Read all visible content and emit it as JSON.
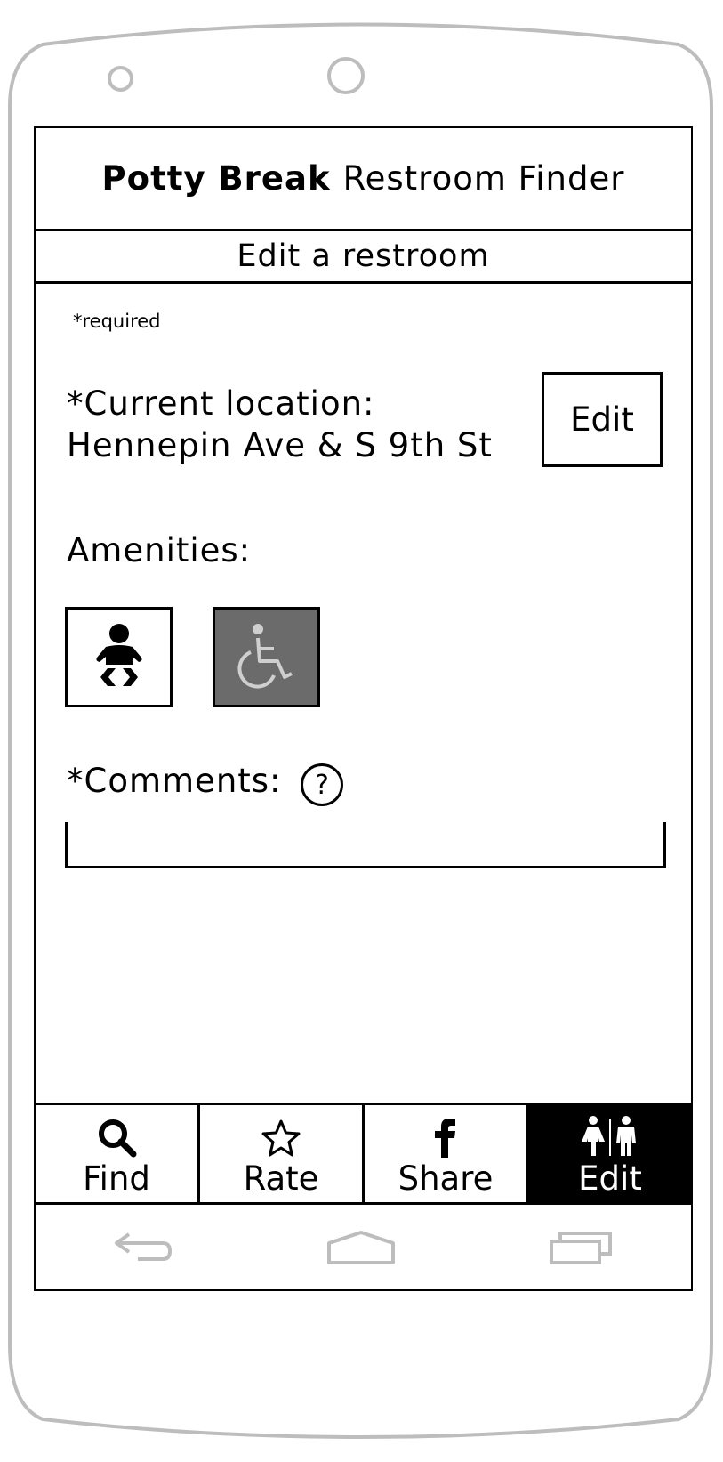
{
  "app": {
    "brand": "Potty Break",
    "title_rest": "Restroom Finder"
  },
  "page": {
    "subtitle": "Edit a restroom",
    "required_note": "*required"
  },
  "location": {
    "label": "*Current location:",
    "value": "Hennepin Ave & S 9th St",
    "edit_label": "Edit"
  },
  "amenities": {
    "label": "Amenities:",
    "items": [
      {
        "icon": "baby-changing-icon",
        "selected": false
      },
      {
        "icon": "wheelchair-icon",
        "selected": true
      }
    ]
  },
  "comments": {
    "label": "*Comments:",
    "help": "?",
    "value": ""
  },
  "tabs": [
    {
      "label": "Find",
      "icon": "search-icon"
    },
    {
      "label": "Rate",
      "icon": "star-icon"
    },
    {
      "label": "Share",
      "icon": "facebook-icon"
    },
    {
      "label": "Edit",
      "icon": "restroom-icon",
      "active": true
    }
  ],
  "system_nav": [
    "back-icon",
    "home-icon",
    "recents-icon"
  ],
  "colors": {
    "frame": "#bdbdbd",
    "selected_amenity": "#6b6b6b",
    "active_tab": "#000000"
  }
}
